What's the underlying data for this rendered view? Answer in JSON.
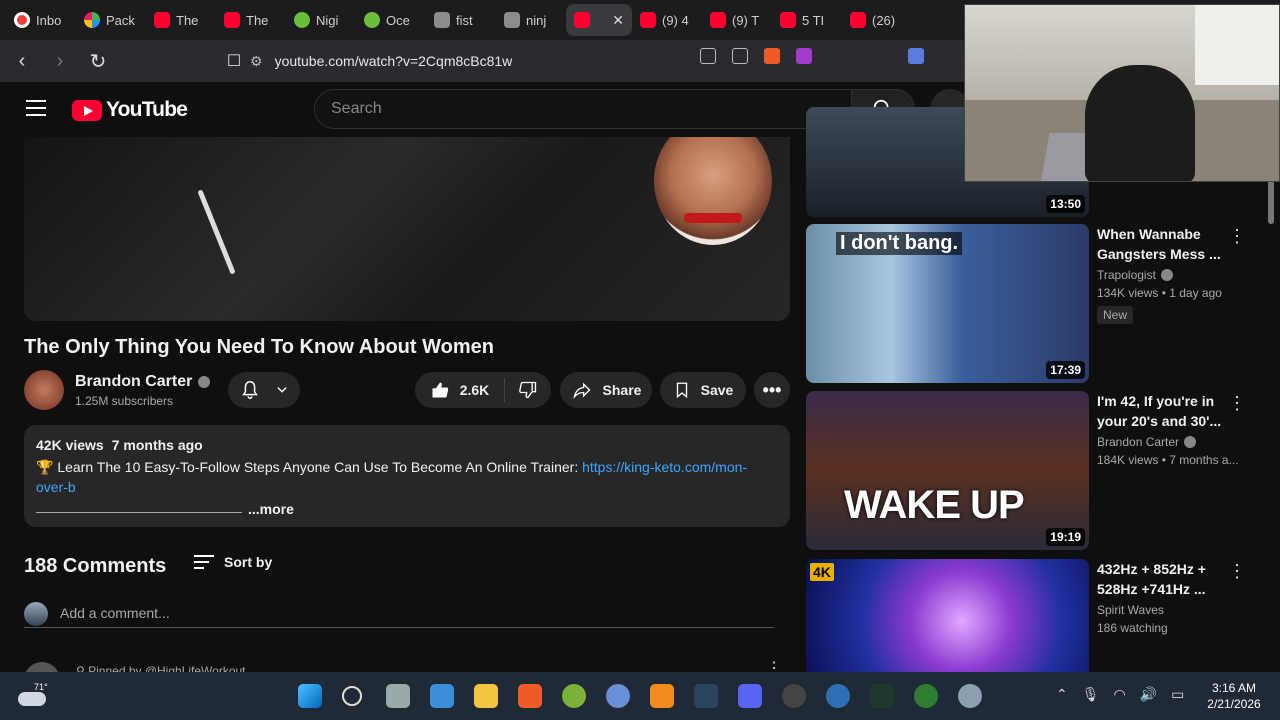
{
  "browser": {
    "tabs": [
      {
        "label": "Inbo",
        "icon": "gmail-icon",
        "kind": "gmail"
      },
      {
        "label": "Pack",
        "icon": "app-icon",
        "kind": "pack"
      },
      {
        "label": "The",
        "icon": "youtube-icon",
        "kind": "yt"
      },
      {
        "label": "The",
        "icon": "youtube-icon",
        "kind": "yt"
      },
      {
        "label": "Nigi",
        "icon": "play-icon",
        "kind": "play"
      },
      {
        "label": "Oce",
        "icon": "play-icon",
        "kind": "play"
      },
      {
        "label": "fist",
        "icon": "brave-icon",
        "kind": "brave"
      },
      {
        "label": "ninj",
        "icon": "brave-icon",
        "kind": "brave"
      },
      {
        "label": "",
        "icon": "youtube-icon",
        "kind": "yt",
        "active": true
      },
      {
        "label": "(9) 4",
        "icon": "youtube-icon",
        "kind": "yt"
      },
      {
        "label": "(9) T",
        "icon": "youtube-icon",
        "kind": "yt"
      },
      {
        "label": "5 TI",
        "icon": "youtube-icon",
        "kind": "yt"
      },
      {
        "label": "(26)",
        "icon": "youtube-icon",
        "kind": "yt"
      },
      {
        "label": "",
        "icon": "youtube-icon",
        "kind": "yt"
      }
    ],
    "url": "youtube.com/watch?v=2Cqm8cBc81w"
  },
  "youtube": {
    "logo": "YouTube",
    "search_placeholder": "Search"
  },
  "video": {
    "title": "The Only Thing You Need To Know About Women",
    "channel": "Brandon Carter",
    "subscribers": "1.25M subscribers",
    "likes": "2.6K",
    "share_label": "Share",
    "save_label": "Save",
    "views": "42K views",
    "age": "7 months ago",
    "desc_emoji": "🏆",
    "desc_text": " Learn The 10 Easy-To-Follow Steps Anyone Can Use To Become An Online Trainer: ",
    "desc_link": "https://king-keto.com/mon-over-b",
    "more_label": "...more"
  },
  "comments": {
    "count": "188 Comments",
    "sort_label": "Sort by",
    "add_placeholder": "Add a comment...",
    "pinned_by": "Pinned by @HighLifeWorkout"
  },
  "sidebar": [
    {
      "title": "",
      "channel": "",
      "meta": "",
      "duration": "13:50",
      "badge": ""
    },
    {
      "title": "When Wannabe Gangsters Mess ...",
      "channel": "Trapologist",
      "meta": "134K views • 1 day ago",
      "duration": "17:39",
      "badge": "New",
      "thumb_text": "I don't bang."
    },
    {
      "title": "I'm 42, If you're in your 20's and 30'...",
      "channel": "Brandon Carter",
      "meta": "184K views • 7 months a...",
      "duration": "19:19",
      "badge": "",
      "thumb_text": "WAKE UP"
    },
    {
      "title": "432Hz + 852Hz + 528Hz +741Hz ...",
      "channel": "Spirit Waves",
      "meta": "186 watching",
      "duration": "",
      "badge": "",
      "thumb_text": "4K"
    }
  ],
  "taskbar": {
    "temperature": "71°",
    "time": "3:16 AM",
    "date": "2/21/2026"
  },
  "colors": {
    "background": "#0f0f0f",
    "youtube_red": "#ff0033",
    "link": "#3ea6ff",
    "surface": "#272727"
  }
}
